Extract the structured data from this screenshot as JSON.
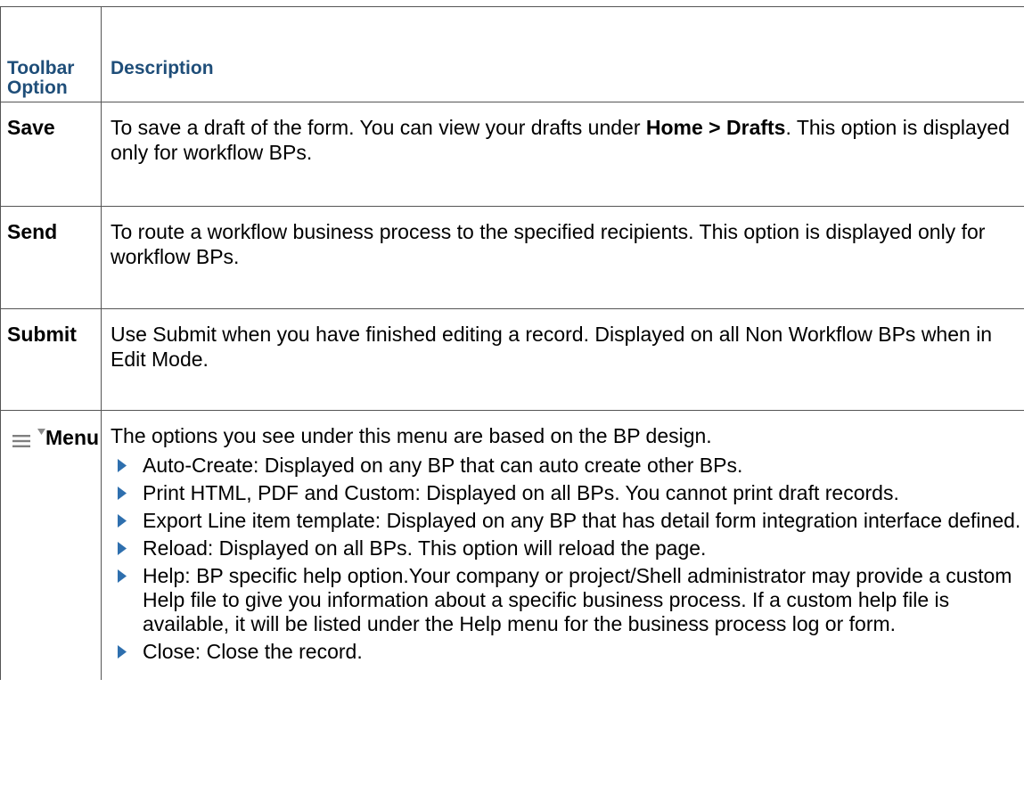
{
  "table": {
    "headers": {
      "col1": "Toolbar Option",
      "col2": "Description"
    },
    "rows": [
      {
        "option": "Save",
        "description_parts": {
          "a": "To save a draft of the form. You can view your drafts under ",
          "b_bold": "Home > Drafts",
          "c": ". This option is displayed only for workflow BPs."
        }
      },
      {
        "option": "Send",
        "description": "To route a workflow business process to the specified recipients. This option is displayed only for workflow BPs."
      },
      {
        "option": "Submit",
        "description": "Use Submit when you have finished editing a record. Displayed on all Non Workflow BPs when in Edit Mode."
      },
      {
        "option": "Menu",
        "intro": "The options you see under this menu are based on the BP design.",
        "bullets": [
          "Auto-Create: Displayed on any BP that can auto create other BPs.",
          "Print HTML, PDF and Custom: Displayed on all BPs. You cannot print draft records.",
          "Export Line item template: Displayed on any BP that has detail form integration interface defined.",
          "Reload: Displayed on all BPs. This option will reload the page.",
          "Help: BP specific help option.Your company or project/Shell administrator may provide a custom Help file to give you information about a specific business process. If a custom help file is available, it will be listed under the Help menu for the business process log or form.",
          "Close: Close the record."
        ]
      }
    ]
  },
  "colors": {
    "header_text": "#1f4e79",
    "bullet": "#2e6fae",
    "icon": "#7f7f7f",
    "border": "#555555"
  },
  "icons": {
    "menu": "hamburger-icon",
    "dropdown": "caret-down-icon",
    "bullet": "triangle-right-icon"
  }
}
